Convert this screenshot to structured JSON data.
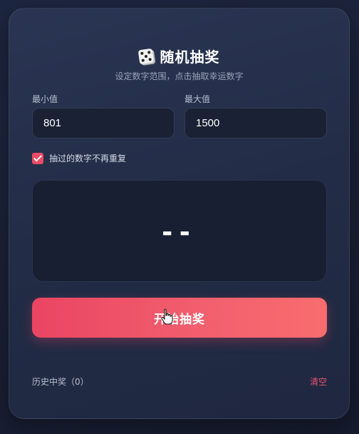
{
  "header": {
    "icon": "die-icon",
    "title": "随机抽奖",
    "subtitle": "设定数字范围，点击抽取幸运数字"
  },
  "range": {
    "min_label": "最小值",
    "min_value": "801",
    "max_label": "最大值",
    "max_value": "1500"
  },
  "options": {
    "no_repeat_label": "抽过的数字不再重复",
    "no_repeat_checked": true
  },
  "display": {
    "value": "--"
  },
  "actions": {
    "start_label": "开始抽奖"
  },
  "history": {
    "label": "历史中奖（0）",
    "clear_label": "清空"
  },
  "colors": {
    "accent": "#ea4b66",
    "card_bg": "#242e49",
    "input_bg": "#1a2134"
  }
}
